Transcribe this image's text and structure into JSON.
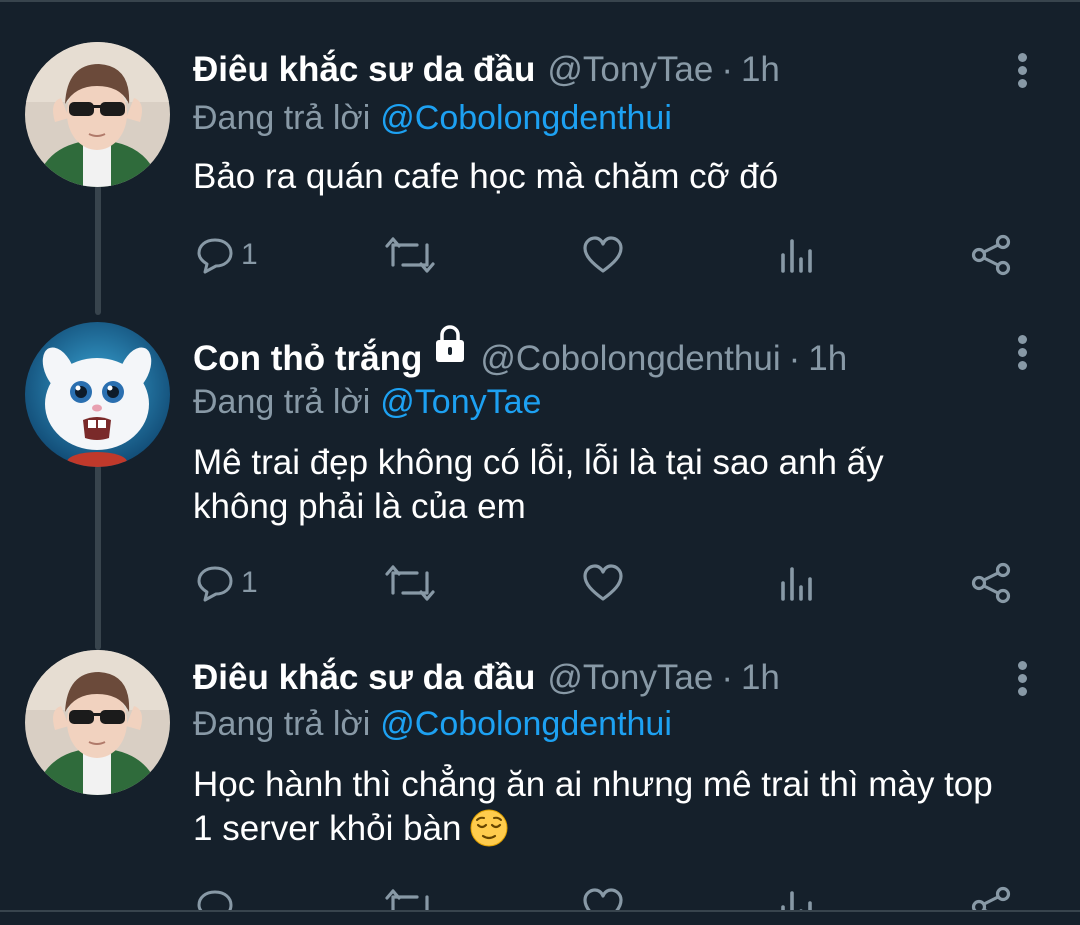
{
  "thread": [
    {
      "name": "Điêu khắc sư da đầu",
      "handle": "@TonyTae",
      "separator": "·",
      "time": "1h",
      "replying_prefix": "Đang trả lời",
      "replying_to": "@Cobolongdenthui",
      "text": "Bảo ra quán cafe học mà chăm cỡ đó",
      "reply_count": "1",
      "avatar": "boy-with-sunglasses-avatar",
      "protected": false
    },
    {
      "name": "Con thỏ trắng",
      "handle": "@Cobolongdenthui",
      "separator": "·",
      "time": "1h",
      "replying_prefix": "Đang trả lời",
      "replying_to": "@TonyTae",
      "text": "Mê trai đẹp không có lỗi, lỗi là tại sao anh ấy không phải là của em",
      "reply_count": "1",
      "avatar": "white-bunny-avatar",
      "protected": true
    },
    {
      "name": "Điêu khắc sư da đầu",
      "handle": "@TonyTae",
      "separator": "·",
      "time": "1h",
      "replying_prefix": "Đang trả lời",
      "replying_to": "@Cobolongdenthui",
      "text": "Học hành thì chẳng ăn ai nhưng mê trai thì mày top 1 server khỏi bàn",
      "text_emoji": "relieved-face-emoji",
      "avatar": "boy-with-sunglasses-avatar",
      "protected": false
    }
  ],
  "icons": {
    "reply": "reply-icon",
    "retweet": "retweet-icon",
    "like": "like-icon",
    "analytics": "analytics-icon",
    "share": "share-icon",
    "more": "more-options-icon",
    "lock": "lock-icon"
  },
  "colors": {
    "background": "#15202b",
    "text": "#ffffff",
    "secondary": "#8899a6",
    "link": "#1da1f2",
    "divider": "#38444d"
  }
}
